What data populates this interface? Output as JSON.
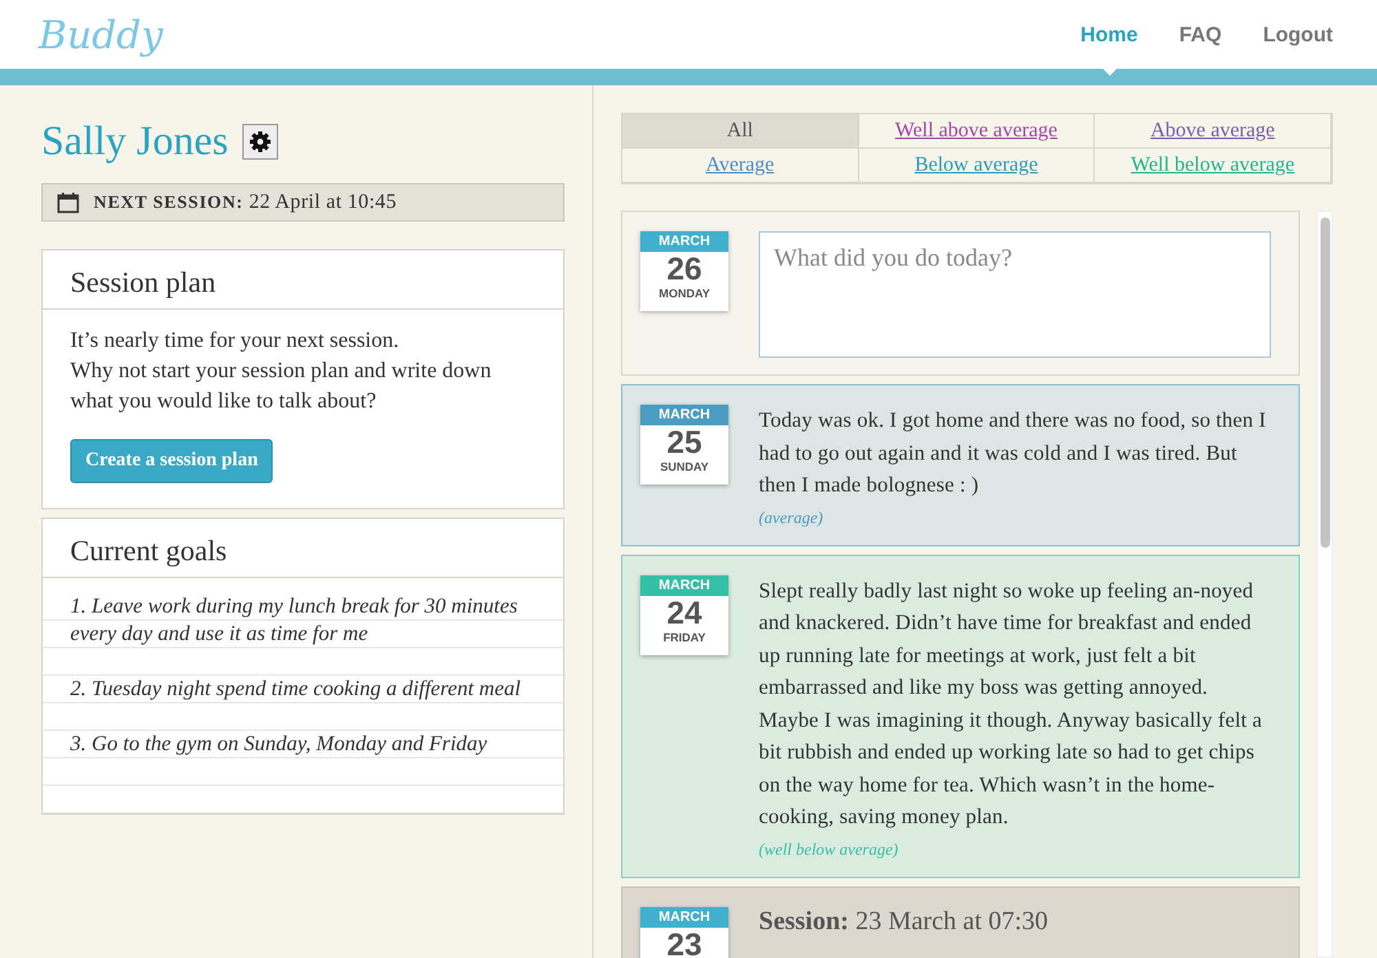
{
  "header": {
    "logo": "Buddy",
    "nav": [
      {
        "label": "Home",
        "selected": true
      },
      {
        "label": "FAQ",
        "selected": false
      },
      {
        "label": "Logout",
        "selected": false
      }
    ]
  },
  "profile": {
    "name": "Sally Jones",
    "next_session": "**NEXT SESSION:** 22 April at 10:45"
  },
  "session_plan": {
    "title": "Session plan",
    "text": "It’s nearly time for your next session.\nWhy not start your session plan and write down what you would like to talk about?",
    "button": "Create a session plan"
  },
  "goals": {
    "title": "Current goals",
    "items": [
      "1. Leave work during my lunch break for 30 minutes every day and use it as time for me",
      "2. Tuesday night spend time cooking a different meal",
      "3. Go to the gym on Sunday, Monday and Friday"
    ]
  },
  "filters": [
    {
      "label": "All",
      "selected": true,
      "color": "#555555"
    },
    {
      "label": "Well above average",
      "selected": false,
      "color": "#a646a8"
    },
    {
      "label": "Above average",
      "selected": false,
      "color": "#7a5cb0"
    },
    {
      "label": "Average",
      "selected": false,
      "color": "#4a8cc8"
    },
    {
      "label": "Below average",
      "selected": false,
      "color": "#2d9bb8"
    },
    {
      "label": "Well below average",
      "selected": false,
      "color": "#1fb590"
    }
  ],
  "entries": [
    {
      "kind": "new",
      "month": "MARCH",
      "day": "26",
      "weekday": "MONDAY",
      "color": "#3fb1cf",
      "placeholder": "What did you do today?"
    },
    {
      "kind": "diary",
      "month": "MARCH",
      "day": "25",
      "weekday": "SUNDAY",
      "color": "#4a9cc0",
      "text": "Today was ok. I got home and there was no food, so then I had to go out again and it was cold and I was tired. But then I made bolognese : )",
      "rating": "(average)"
    },
    {
      "kind": "diary",
      "month": "MARCH",
      "day": "24",
      "weekday": "FRIDAY",
      "color": "#35bfa6",
      "text": "Slept really badly last night so woke up feeling an-noyed and knackered. Didn’t have time for breakfast and ended up running late for meetings at work, just felt a bit embarrassed and like my boss was getting annoyed. Maybe I was imagining it though. Anyway basically felt a bit rubbish and ended up working late so had to get chips on the way home for tea. Which wasn’t in the home-cooking, saving money plan.",
      "rating": "(well below average)"
    },
    {
      "kind": "session",
      "month": "MARCH",
      "day": "23",
      "color": "#3fb1cf",
      "text": "**Session:** 23 March at 07:30"
    }
  ]
}
